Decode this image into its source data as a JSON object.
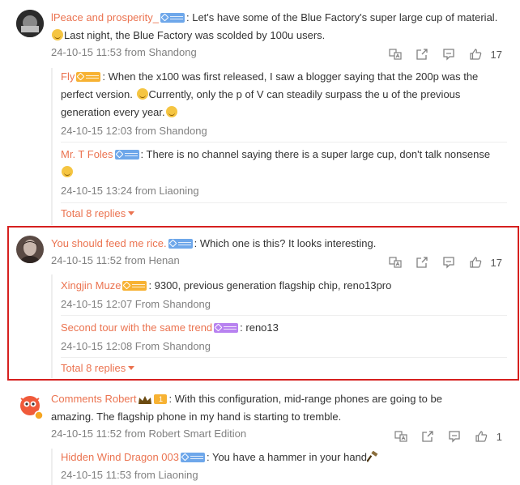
{
  "comments": [
    {
      "user": "lPeace and prosperity_",
      "text_a": ": Let's have some of the Blue Factory's super large cup of material.",
      "text_b": "Last night, the Blue Factory was scolded by 100u users.",
      "meta": "24-10-15 11:53 from Shandong",
      "likes": "17",
      "replies": [
        {
          "user": "Fly",
          "text_a": ": When the x100 was first released, I saw a blogger saying that the 200p was the",
          "text_b": "perfect version.",
          "text_c": "Currently, only the p of V can steadily surpass the u of the previous",
          "text_d": "generation every year.",
          "meta": "24-10-15 12:03 from Shandong"
        },
        {
          "user": "Mr. T Foles",
          "text_a": ": There is no channel saying there is a super large cup, don't talk nonsense",
          "meta": "24-10-15 13:24 from Liaoning"
        }
      ],
      "total": "Total 8 replies"
    },
    {
      "user": "You should feed me rice.",
      "text_a": ": Which one is this? It looks interesting.",
      "meta": "24-10-15 11:52 from Henan",
      "likes": "17",
      "replies": [
        {
          "user": "Xingjin Muze",
          "text_a": ": 9300, previous generation flagship chip, reno13pro",
          "meta": "24-10-15 12:07 From Shandong"
        },
        {
          "user": "Second tour with the same trend",
          "text_a": ": reno13",
          "meta": "24-10-15 12:08 From Shandong"
        }
      ],
      "total": "Total 8 replies"
    },
    {
      "user": "Comments Robert",
      "badge_level": "1",
      "text_a": ": With this configuration, mid-range phones are going to be",
      "text_b": "amazing. The flagship phone in my hand is starting to tremble.",
      "meta": "24-10-15 11:52 from Robert Smart Edition",
      "likes": "1",
      "replies": [
        {
          "user": "Hidden Wind Dragon 003",
          "text_a": ": You have a hammer in your hand",
          "meta": "24-10-15 11:53 from Liaoning"
        }
      ]
    }
  ],
  "colors": {
    "username": "#eb7350",
    "meta": "#808080",
    "highlight": "#d6201f"
  },
  "icons": [
    "translate-icon",
    "share-icon",
    "comment-icon",
    "like-icon",
    "emoji-icon",
    "hammer-icon",
    "crown-icon",
    "badge-icon"
  ]
}
